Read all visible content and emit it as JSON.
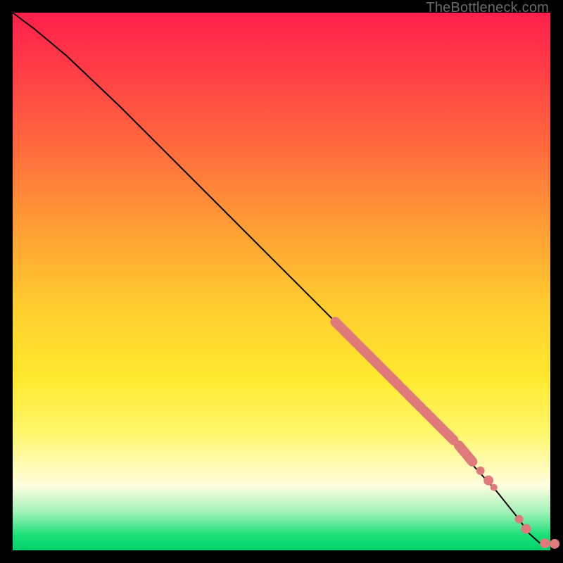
{
  "watermark": "TheBottleneck.com",
  "chart_data": {
    "type": "line",
    "title": "",
    "xlabel": "",
    "ylabel": "",
    "xlim": [
      0,
      100
    ],
    "ylim": [
      0,
      100
    ],
    "curve": {
      "x": [
        0,
        4,
        10,
        20,
        30,
        40,
        50,
        60,
        70,
        80,
        85,
        90,
        94,
        96,
        98,
        100
      ],
      "y": [
        100,
        97,
        92,
        82.5,
        72.5,
        62.5,
        52.5,
        42.5,
        32.5,
        22,
        16.5,
        11,
        6,
        3.2,
        1.4,
        1.2
      ]
    },
    "clusters": [
      {
        "x0": 60,
        "y0": 42.5,
        "x1": 64,
        "y1": 38.5
      },
      {
        "x0": 64.5,
        "y0": 38,
        "x1": 72,
        "y1": 30.5
      },
      {
        "x0": 72.5,
        "y0": 30,
        "x1": 76,
        "y1": 26.5
      },
      {
        "x0": 76.5,
        "y0": 26,
        "x1": 82,
        "y1": 20.5
      },
      {
        "x0": 83,
        "y0": 19.5,
        "x1": 85.5,
        "y1": 16.5
      }
    ],
    "points": [
      {
        "x": 87,
        "y": 14.8,
        "r": 6
      },
      {
        "x": 88.5,
        "y": 13,
        "r": 7
      },
      {
        "x": 89.5,
        "y": 11.7,
        "r": 5
      },
      {
        "x": 94.2,
        "y": 5.8,
        "r": 6
      },
      {
        "x": 95.5,
        "y": 4.0,
        "r": 7
      },
      {
        "x": 99,
        "y": 1.3,
        "r": 7
      },
      {
        "x": 100.8,
        "y": 1.2,
        "r": 7
      }
    ],
    "gradient_stops": [
      {
        "pos": 0,
        "color": "#ff1f4b"
      },
      {
        "pos": 25,
        "color": "#ff6a3d"
      },
      {
        "pos": 55,
        "color": "#ffce2e"
      },
      {
        "pos": 78,
        "color": "#fff66a"
      },
      {
        "pos": 93,
        "color": "#9ef2b6"
      },
      {
        "pos": 100,
        "color": "#00d169"
      }
    ]
  }
}
